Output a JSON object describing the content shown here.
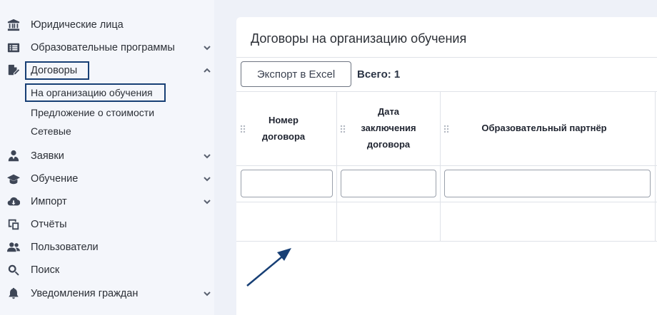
{
  "sidebar": {
    "items": [
      {
        "label": "Юридические лица",
        "icon": "bank-icon",
        "has_chevron": false
      },
      {
        "label": "Образовательные программы",
        "icon": "list-icon",
        "has_chevron": true,
        "chevron": "down"
      },
      {
        "label": "Договоры",
        "icon": "file-signature-icon",
        "has_chevron": true,
        "chevron": "up"
      },
      {
        "label": "Заявки",
        "icon": "user-tie-icon",
        "has_chevron": true,
        "chevron": "down"
      },
      {
        "label": "Обучение",
        "icon": "graduation-cap-icon",
        "has_chevron": true,
        "chevron": "down"
      },
      {
        "label": "Импорт",
        "icon": "cloud-download-icon",
        "has_chevron": true,
        "chevron": "down"
      },
      {
        "label": "Отчёты",
        "icon": "report-icon",
        "has_chevron": false
      },
      {
        "label": "Пользователи",
        "icon": "users-icon",
        "has_chevron": false
      },
      {
        "label": "Поиск",
        "icon": "search-icon",
        "has_chevron": false
      },
      {
        "label": "Уведомления граждан",
        "icon": "bell-icon",
        "has_chevron": true,
        "chevron": "down"
      }
    ],
    "subitems": [
      {
        "label": "На организацию обучения",
        "active": true
      },
      {
        "label": "Предложение о стоимости",
        "active": false
      },
      {
        "label": "Сетевые",
        "active": false
      }
    ]
  },
  "main": {
    "title": "Договоры на организацию обучения",
    "export_label": "Экспорт в Excel",
    "total_label": "Всего: 1",
    "columns": [
      {
        "lines": [
          "Номер",
          "договора"
        ]
      },
      {
        "lines": [
          "Дата",
          "заключения",
          "договора"
        ]
      },
      {
        "lines": [
          "Образовательный партнёр"
        ]
      }
    ]
  },
  "colors": {
    "accent": "#173f75",
    "page_bg": "#eef1f8",
    "sidebar_bg": "#f4f6fb",
    "card_bg": "#ffffff"
  }
}
